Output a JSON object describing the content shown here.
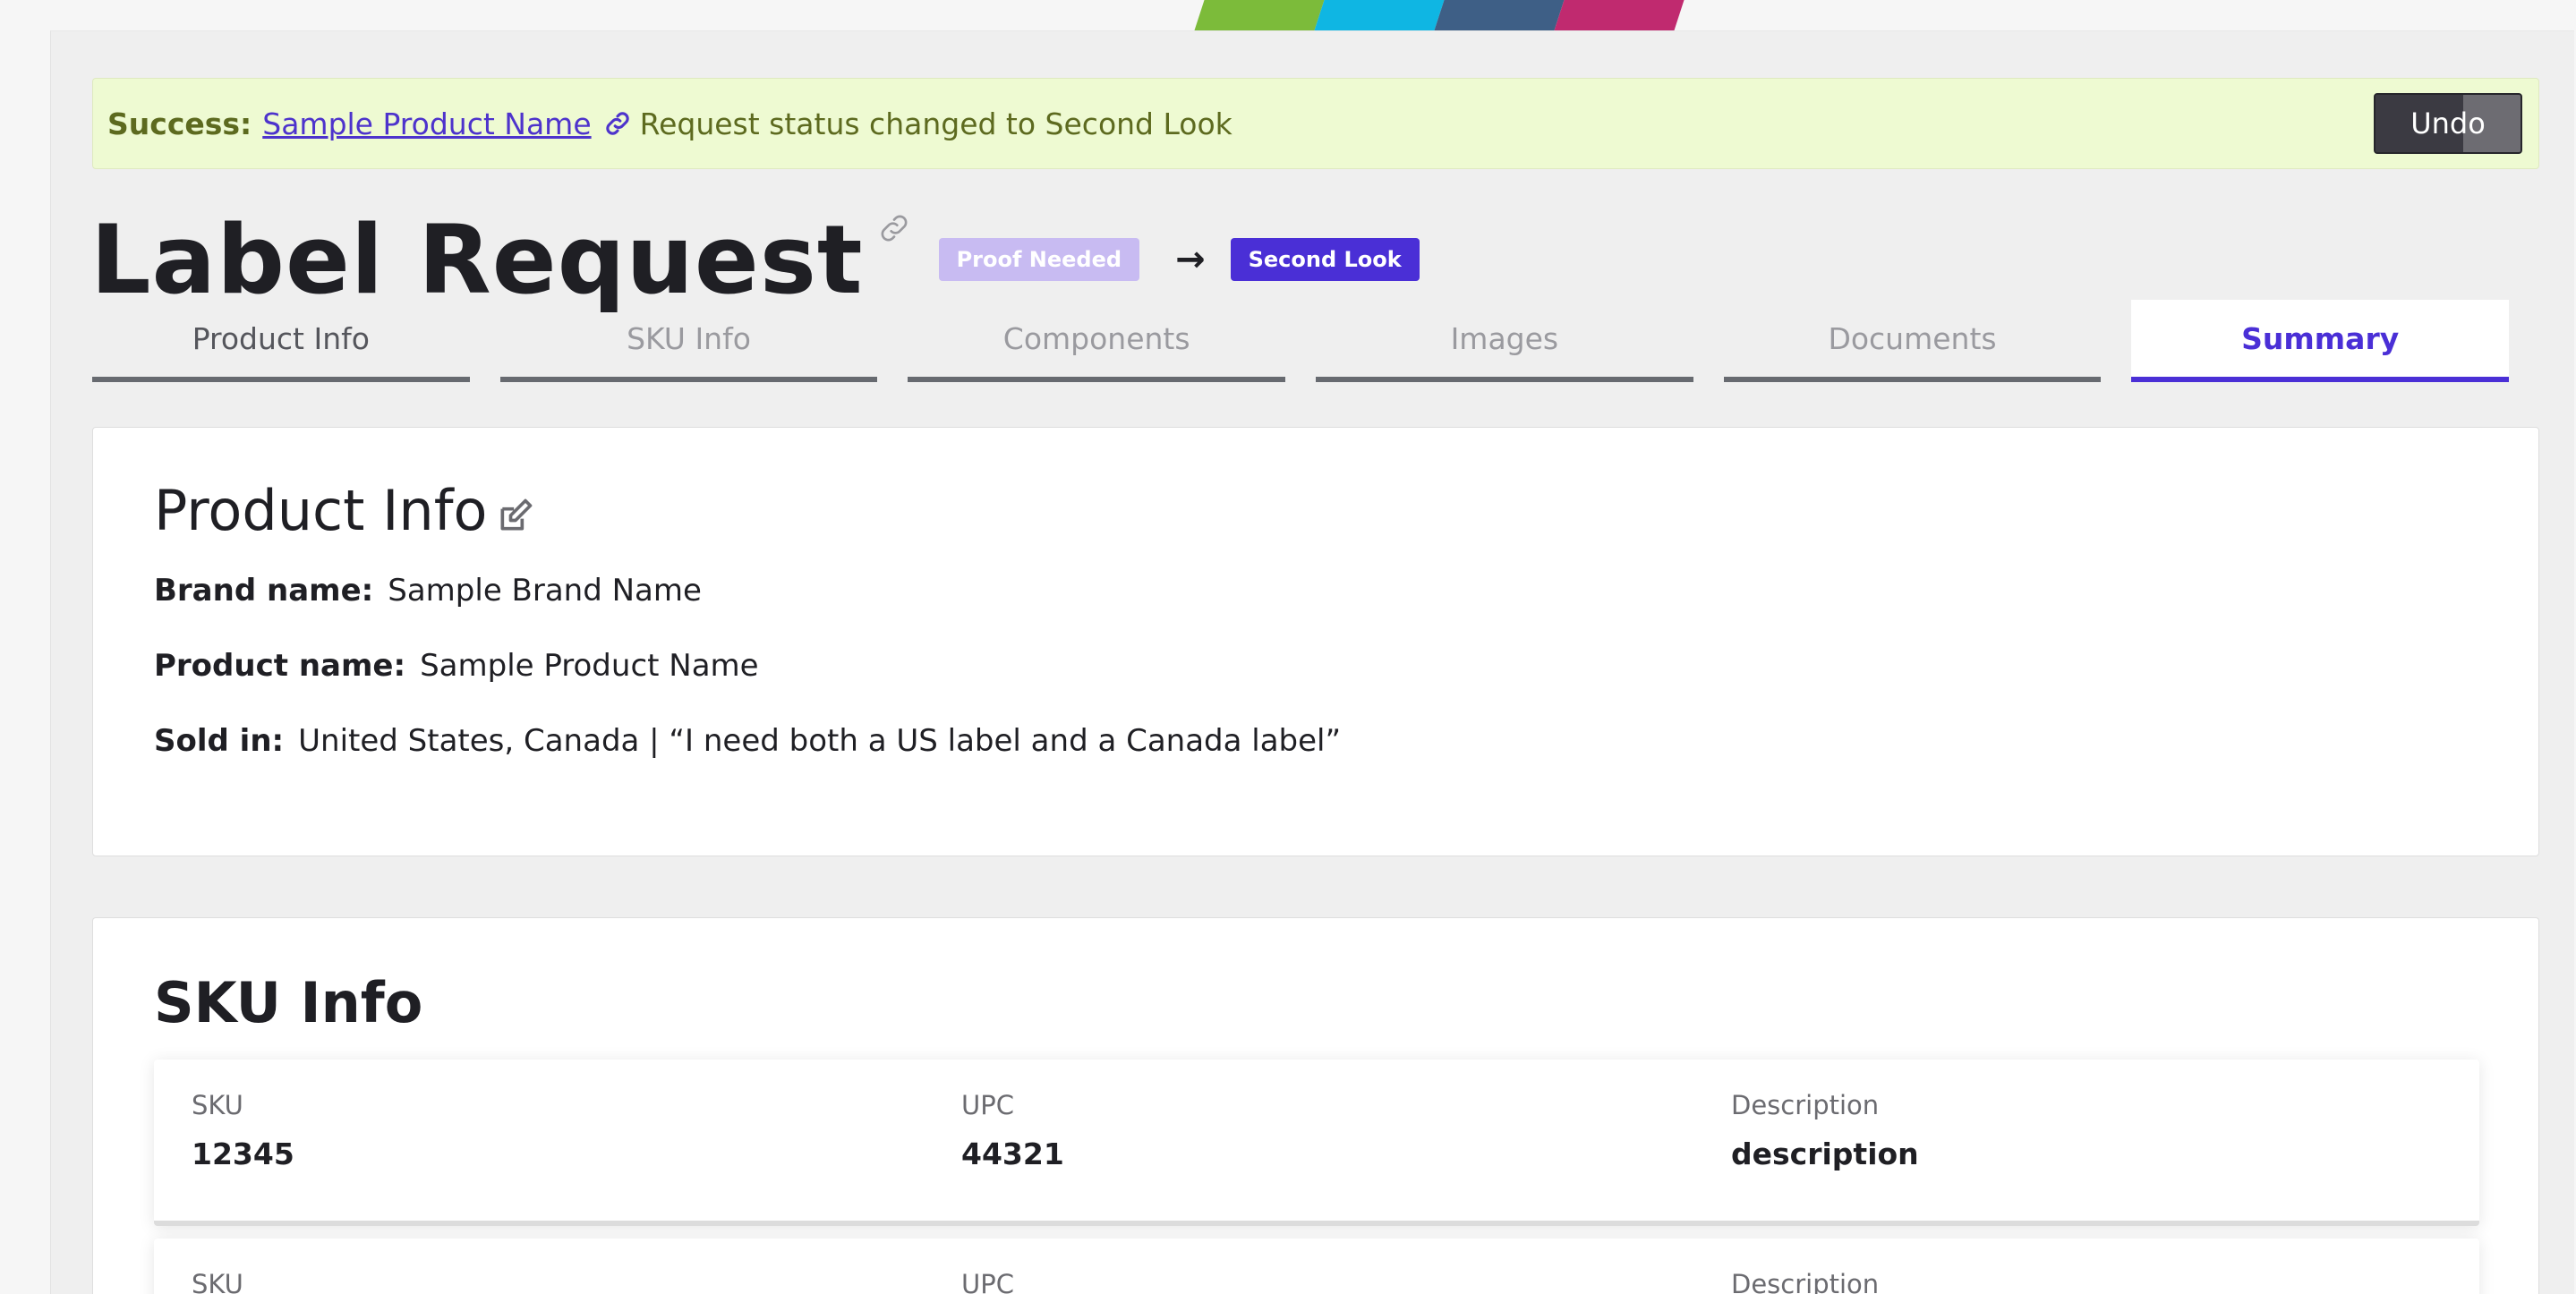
{
  "colors": {
    "stripe1": "#7cbb3a",
    "stripe2": "#0fb6e3",
    "stripe3": "#3e5f86",
    "stripe4": "#c02a6f",
    "accent": "#4a2fd6",
    "success_bg": "#eefad2"
  },
  "banner": {
    "label": "Success:",
    "product_link": "Sample Product Name",
    "message": "Request status changed to Second Look",
    "undo_label": "Undo",
    "icon": "link-icon"
  },
  "header": {
    "title": "Label Request",
    "title_icon": "link-icon",
    "status_from": "Proof Needed",
    "arrow": "→",
    "status_to": "Second Look"
  },
  "tabs": [
    {
      "label": "Product Info"
    },
    {
      "label": "SKU Info"
    },
    {
      "label": "Components"
    },
    {
      "label": "Images"
    },
    {
      "label": "Documents"
    },
    {
      "label": "Summary",
      "active": true
    }
  ],
  "product_info": {
    "title": "Product Info",
    "edit_icon": "edit-icon",
    "brand_label": "Brand name:",
    "brand_value": "Sample Brand Name",
    "product_label": "Product name:",
    "product_value": "Sample Product Name",
    "sold_label": "Sold in:",
    "sold_value": "United States, Canada | “I need both a US label and a Canada label”"
  },
  "sku_info": {
    "title": "SKU Info",
    "rows": [
      {
        "sku_label": "SKU",
        "sku": "12345",
        "upc_label": "UPC",
        "upc": "44321",
        "desc_label": "Description",
        "desc": "description"
      },
      {
        "sku_label": "SKU",
        "upc_label": "UPC",
        "desc_label": "Description"
      }
    ]
  }
}
